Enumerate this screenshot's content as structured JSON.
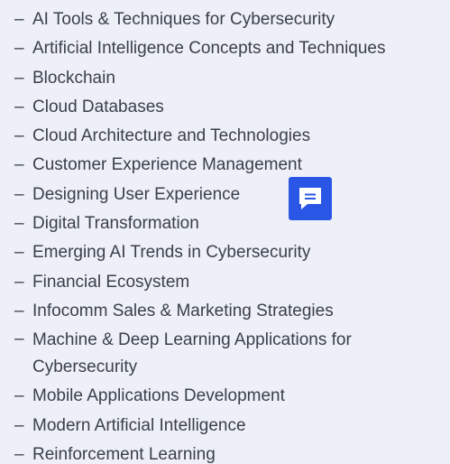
{
  "course_list": {
    "bullet": "–",
    "items": [
      "AI Tools & Techniques for Cybersecurity",
      "Artificial Intelligence Concepts and Techniques",
      "Blockchain",
      "Cloud Databases",
      "Cloud Architecture and Technologies",
      "Customer Experience Management",
      "Designing User Experience",
      "Digital Transformation",
      "Emerging AI Trends in Cybersecurity",
      "Financial Ecosystem",
      "Infocomm Sales & Marketing Strategies",
      "Machine & Deep Learning Applications for Cybersecurity",
      "Mobile Applications Development",
      "Modern Artificial Intelligence",
      "Reinforcement Learning"
    ]
  },
  "chat_widget": {
    "icon": "chat-message-icon",
    "color": "#2a56e6"
  }
}
